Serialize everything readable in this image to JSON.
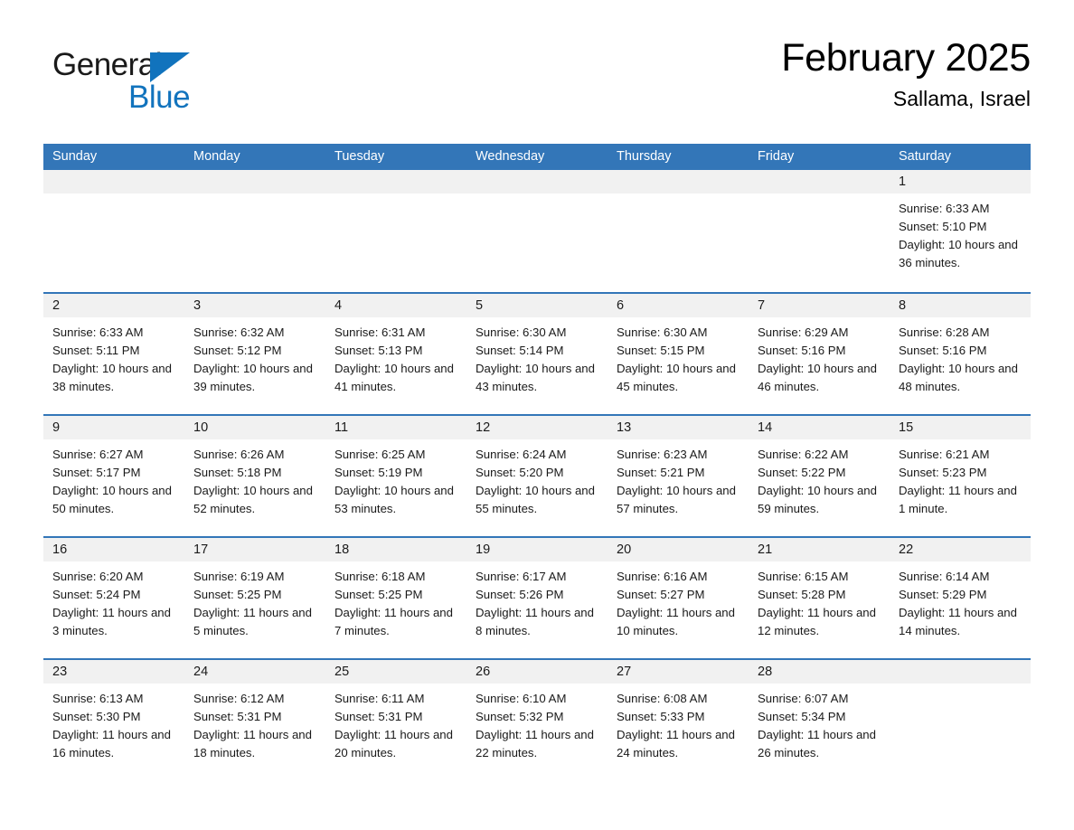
{
  "brand": {
    "word_general": "General",
    "word_blue": "Blue",
    "accent_color": "#1173bd"
  },
  "header": {
    "title": "February 2025",
    "subtitle": "Sallama, Israel",
    "header_bg": "#3376b8",
    "band_bg": "#f1f1f1"
  },
  "weekday_headers": [
    "Sunday",
    "Monday",
    "Tuesday",
    "Wednesday",
    "Thursday",
    "Friday",
    "Saturday"
  ],
  "labels": {
    "sunrise_prefix": "Sunrise:",
    "sunset_prefix": "Sunset:",
    "daylight_prefix": "Daylight:"
  },
  "weeks": [
    [
      {
        "empty": true
      },
      {
        "empty": true
      },
      {
        "empty": true
      },
      {
        "empty": true
      },
      {
        "empty": true
      },
      {
        "empty": true
      },
      {
        "empty": false,
        "day": "1",
        "sunrise": "Sunrise: 6:33 AM",
        "sunset": "Sunset: 5:10 PM",
        "daylight": "Daylight: 10 hours and 36 minutes."
      }
    ],
    [
      {
        "empty": false,
        "day": "2",
        "sunrise": "Sunrise: 6:33 AM",
        "sunset": "Sunset: 5:11 PM",
        "daylight": "Daylight: 10 hours and 38 minutes."
      },
      {
        "empty": false,
        "day": "3",
        "sunrise": "Sunrise: 6:32 AM",
        "sunset": "Sunset: 5:12 PM",
        "daylight": "Daylight: 10 hours and 39 minutes."
      },
      {
        "empty": false,
        "day": "4",
        "sunrise": "Sunrise: 6:31 AM",
        "sunset": "Sunset: 5:13 PM",
        "daylight": "Daylight: 10 hours and 41 minutes."
      },
      {
        "empty": false,
        "day": "5",
        "sunrise": "Sunrise: 6:30 AM",
        "sunset": "Sunset: 5:14 PM",
        "daylight": "Daylight: 10 hours and 43 minutes."
      },
      {
        "empty": false,
        "day": "6",
        "sunrise": "Sunrise: 6:30 AM",
        "sunset": "Sunset: 5:15 PM",
        "daylight": "Daylight: 10 hours and 45 minutes."
      },
      {
        "empty": false,
        "day": "7",
        "sunrise": "Sunrise: 6:29 AM",
        "sunset": "Sunset: 5:16 PM",
        "daylight": "Daylight: 10 hours and 46 minutes."
      },
      {
        "empty": false,
        "day": "8",
        "sunrise": "Sunrise: 6:28 AM",
        "sunset": "Sunset: 5:16 PM",
        "daylight": "Daylight: 10 hours and 48 minutes."
      }
    ],
    [
      {
        "empty": false,
        "day": "9",
        "sunrise": "Sunrise: 6:27 AM",
        "sunset": "Sunset: 5:17 PM",
        "daylight": "Daylight: 10 hours and 50 minutes."
      },
      {
        "empty": false,
        "day": "10",
        "sunrise": "Sunrise: 6:26 AM",
        "sunset": "Sunset: 5:18 PM",
        "daylight": "Daylight: 10 hours and 52 minutes."
      },
      {
        "empty": false,
        "day": "11",
        "sunrise": "Sunrise: 6:25 AM",
        "sunset": "Sunset: 5:19 PM",
        "daylight": "Daylight: 10 hours and 53 minutes."
      },
      {
        "empty": false,
        "day": "12",
        "sunrise": "Sunrise: 6:24 AM",
        "sunset": "Sunset: 5:20 PM",
        "daylight": "Daylight: 10 hours and 55 minutes."
      },
      {
        "empty": false,
        "day": "13",
        "sunrise": "Sunrise: 6:23 AM",
        "sunset": "Sunset: 5:21 PM",
        "daylight": "Daylight: 10 hours and 57 minutes."
      },
      {
        "empty": false,
        "day": "14",
        "sunrise": "Sunrise: 6:22 AM",
        "sunset": "Sunset: 5:22 PM",
        "daylight": "Daylight: 10 hours and 59 minutes."
      },
      {
        "empty": false,
        "day": "15",
        "sunrise": "Sunrise: 6:21 AM",
        "sunset": "Sunset: 5:23 PM",
        "daylight": "Daylight: 11 hours and 1 minute."
      }
    ],
    [
      {
        "empty": false,
        "day": "16",
        "sunrise": "Sunrise: 6:20 AM",
        "sunset": "Sunset: 5:24 PM",
        "daylight": "Daylight: 11 hours and 3 minutes."
      },
      {
        "empty": false,
        "day": "17",
        "sunrise": "Sunrise: 6:19 AM",
        "sunset": "Sunset: 5:25 PM",
        "daylight": "Daylight: 11 hours and 5 minutes."
      },
      {
        "empty": false,
        "day": "18",
        "sunrise": "Sunrise: 6:18 AM",
        "sunset": "Sunset: 5:25 PM",
        "daylight": "Daylight: 11 hours and 7 minutes."
      },
      {
        "empty": false,
        "day": "19",
        "sunrise": "Sunrise: 6:17 AM",
        "sunset": "Sunset: 5:26 PM",
        "daylight": "Daylight: 11 hours and 8 minutes."
      },
      {
        "empty": false,
        "day": "20",
        "sunrise": "Sunrise: 6:16 AM",
        "sunset": "Sunset: 5:27 PM",
        "daylight": "Daylight: 11 hours and 10 minutes."
      },
      {
        "empty": false,
        "day": "21",
        "sunrise": "Sunrise: 6:15 AM",
        "sunset": "Sunset: 5:28 PM",
        "daylight": "Daylight: 11 hours and 12 minutes."
      },
      {
        "empty": false,
        "day": "22",
        "sunrise": "Sunrise: 6:14 AM",
        "sunset": "Sunset: 5:29 PM",
        "daylight": "Daylight: 11 hours and 14 minutes."
      }
    ],
    [
      {
        "empty": false,
        "day": "23",
        "sunrise": "Sunrise: 6:13 AM",
        "sunset": "Sunset: 5:30 PM",
        "daylight": "Daylight: 11 hours and 16 minutes."
      },
      {
        "empty": false,
        "day": "24",
        "sunrise": "Sunrise: 6:12 AM",
        "sunset": "Sunset: 5:31 PM",
        "daylight": "Daylight: 11 hours and 18 minutes."
      },
      {
        "empty": false,
        "day": "25",
        "sunrise": "Sunrise: 6:11 AM",
        "sunset": "Sunset: 5:31 PM",
        "daylight": "Daylight: 11 hours and 20 minutes."
      },
      {
        "empty": false,
        "day": "26",
        "sunrise": "Sunrise: 6:10 AM",
        "sunset": "Sunset: 5:32 PM",
        "daylight": "Daylight: 11 hours and 22 minutes."
      },
      {
        "empty": false,
        "day": "27",
        "sunrise": "Sunrise: 6:08 AM",
        "sunset": "Sunset: 5:33 PM",
        "daylight": "Daylight: 11 hours and 24 minutes."
      },
      {
        "empty": false,
        "day": "28",
        "sunrise": "Sunrise: 6:07 AM",
        "sunset": "Sunset: 5:34 PM",
        "daylight": "Daylight: 11 hours and 26 minutes."
      },
      {
        "empty": true
      }
    ]
  ]
}
